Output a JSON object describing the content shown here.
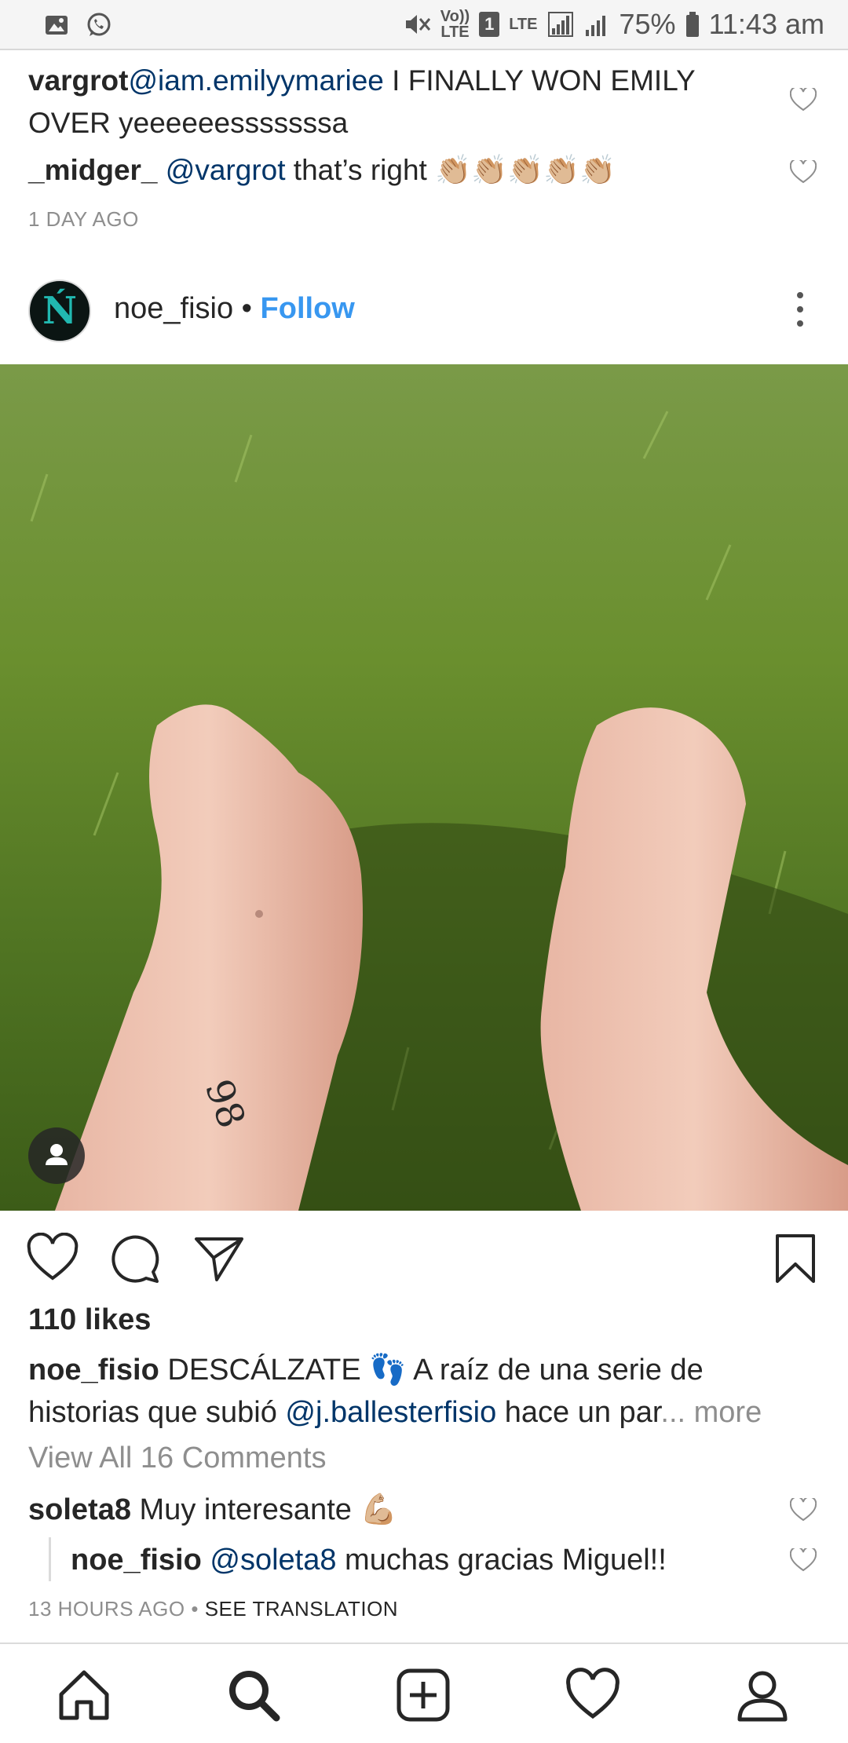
{
  "status_bar": {
    "volte_top": "Vo))",
    "volte_bottom": "LTE",
    "sim_number": "1",
    "lte_label": "LTE",
    "battery": "75%",
    "time": "11:43 am"
  },
  "top_comments": [
    {
      "username": "vargrot",
      "mention": "@iam.emilyymariee",
      "text_line1": " I FINALLY WON EMILY",
      "text_line2": "OVER yeeeeeesssssssa"
    },
    {
      "username": "_midger_",
      "mention": "@vargrot",
      "text": " that’s right ",
      "emoji": "👏🏼👏🏼👏🏼👏🏼👏🏼"
    }
  ],
  "top_timestamp": "1 DAY AGO",
  "post": {
    "username": "noe_fisio",
    "separator": " • ",
    "follow_label": "Follow",
    "avatar_letter": "Ń",
    "likes": "110 likes",
    "caption": {
      "username": "noe_fisio",
      "text1": " DESCÁLZATE ",
      "emoji": "👣",
      "text2": " A raíz de una serie de",
      "text3": "historias que subió ",
      "mention": "@j.ballesterfisio",
      "text4": " hace un par",
      "more": "... more"
    },
    "view_all": "View All 16 Comments",
    "comments": [
      {
        "username": "soleta8",
        "text": " Muy interesante ",
        "emoji": "💪🏼"
      },
      {
        "username": "noe_fisio",
        "mention": "@soleta8",
        "text": " muchas gracias Miguel!!"
      }
    ],
    "timestamp": "13 HOURS AGO",
    "timestamp_sep": " • ",
    "see_translation": "SEE TRANSLATION"
  },
  "colors": {
    "link_blue": "#3897f0",
    "mention_blue": "#003569",
    "grey_text": "#8e8e8e"
  },
  "icons": {
    "nav": [
      "home-icon",
      "search-icon",
      "add-post-icon",
      "activity-heart-icon",
      "profile-icon"
    ],
    "actions": [
      "like-heart-icon",
      "comment-bubble-icon",
      "share-send-icon",
      "bookmark-icon"
    ]
  }
}
